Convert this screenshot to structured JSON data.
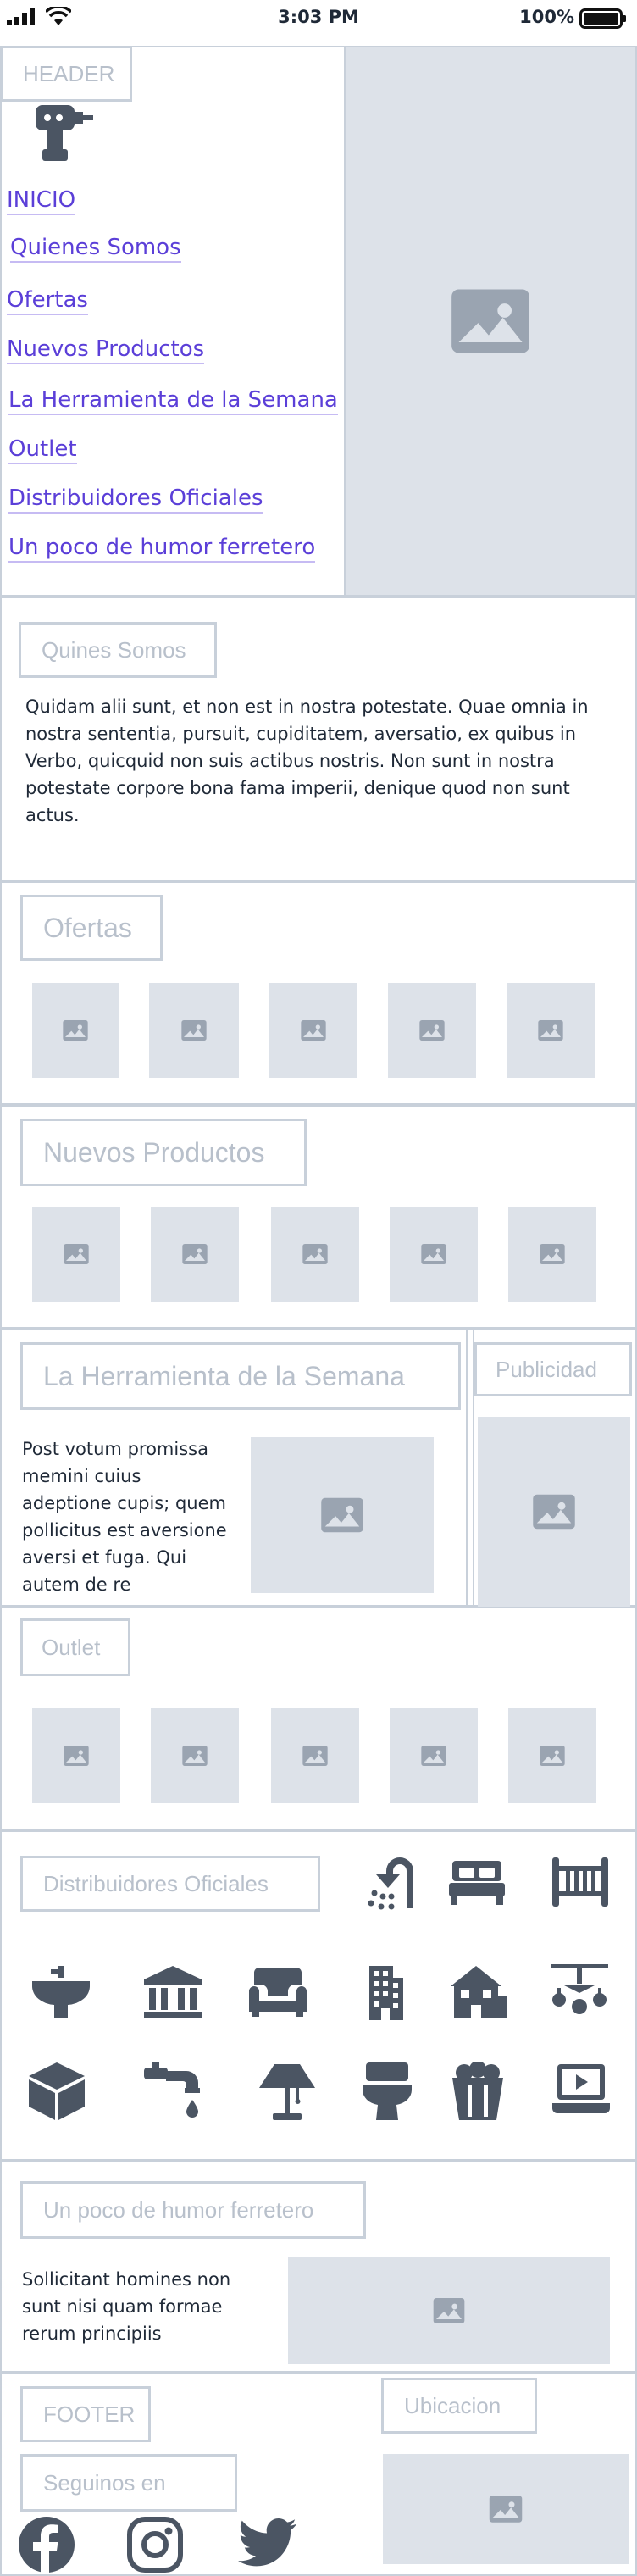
{
  "status": {
    "time": "3:03 PM",
    "battery": "100%"
  },
  "header": {
    "tag": "HEADER",
    "nav": [
      "INICIO",
      "Quienes Somos",
      "Ofertas",
      "Nuevos Productos",
      "La Herramienta de la Semana",
      "Outlet",
      "Distribuidores Oficiales",
      "Un poco de humor ferretero"
    ]
  },
  "quienes": {
    "tag": "Quines Somos",
    "text": "Quidam alii sunt, et non est in nostra potestate. Quae omnia in nostra sententia, pursuit, cupiditatem, aversatio, ex quibus in Verbo, quicquid non suis actibus nostris. Non sunt in nostra potestate corpore bona fama imperii, denique quod non sunt actus."
  },
  "ofertas": {
    "tag": "Ofertas"
  },
  "nuevos": {
    "tag": "Nuevos Productos"
  },
  "herramienta": {
    "tag": "La Herramienta de la Semana",
    "text": "Post votum promissa memini cuius adeptione cupis; quem pollicitus est aversione aversi et fuga. Qui autem de re"
  },
  "publicidad": {
    "tag": "Publicidad"
  },
  "outlet": {
    "tag": "Outlet"
  },
  "distribuidores": {
    "tag": "Distribuidores Oficiales",
    "icons": [
      "shower-icon",
      "bed-icon",
      "crib-icon",
      "sink-icon",
      "bank-icon",
      "armchair-icon",
      "building-icon",
      "house-icon",
      "chandelier-icon",
      "cube-icon",
      "faucet-icon",
      "lamp-icon",
      "toilet-icon",
      "popcorn-icon",
      "laptop-video-icon"
    ]
  },
  "humor": {
    "tag": "Un poco de humor ferretero",
    "text": "Sollicitant homines non sunt nisi quam formae rerum principiis"
  },
  "footer": {
    "tag": "FOOTER",
    "follow": "Seguinos en",
    "location": "Ubicacion",
    "social_icons": [
      "facebook-icon",
      "instagram-icon",
      "twitter-icon"
    ]
  }
}
